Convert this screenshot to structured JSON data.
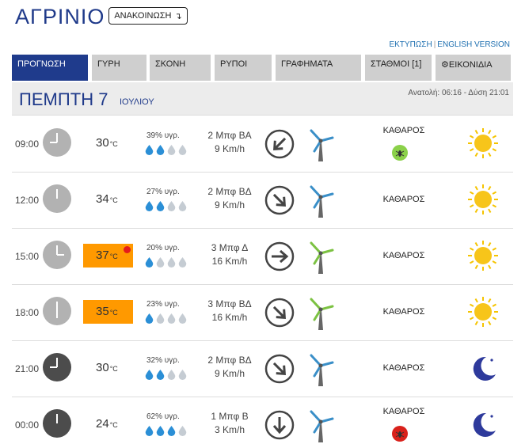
{
  "city": "ΑΓΡΙΝΙΟ",
  "announcement_button": "ΑΝΑΚΟΙΝΩΣΗ",
  "announcement_icon": "arrow-down-turn-icon",
  "links": {
    "print": "ΕΚΤΥΠΩΣΗ",
    "sep": "|",
    "english": "ENGLISH VERSION"
  },
  "tabs": [
    {
      "label": "ΠΡΟΓΝΩΣΗ",
      "active": true
    },
    {
      "label": "ΓΥΡΗ"
    },
    {
      "label": "ΣΚΟΝΗ"
    },
    {
      "label": "ΡΥΠΟΙ"
    },
    {
      "label": "ΓΡΑΦΗΜΑΤΑ"
    },
    {
      "label": "ΣΤΑΘΜΟΙ [1]"
    },
    {
      "label": "ΕΙΚΟΝΙΔΙΑ",
      "icon": "gear-icon"
    }
  ],
  "day": {
    "name": "ΠΕΜΠΤΗ 7",
    "month": "ΙΟΥΛΙΟΥ",
    "sun_times": "Ανατολή: 06:16 - Δύση 21:01"
  },
  "temp_unit": "°C",
  "colors": {
    "accent": "#1f3b8c",
    "hot": "#ff9900",
    "drop_filled": "#2b8fd6",
    "drop_empty": "#c5ccd3"
  },
  "rows": [
    {
      "time": "09:00",
      "clock": "day",
      "hour": 9,
      "temp": "30",
      "hot": false,
      "alert": false,
      "humidity": "39% υγρ.",
      "drops": 2,
      "wind_force": "2 Μπφ ΒΑ",
      "wind_speed": "9 Km/h",
      "arrow_deg": 225,
      "turbine": "blue",
      "condition": "ΚΑΘΑΡΟΣ",
      "badge": "green",
      "weather_icon": "sun-icon"
    },
    {
      "time": "12:00",
      "clock": "day",
      "hour": 12,
      "temp": "34",
      "hot": false,
      "alert": false,
      "humidity": "27% υγρ.",
      "drops": 2,
      "wind_force": "2 Μπφ ΒΔ",
      "wind_speed": "9 Km/h",
      "arrow_deg": 135,
      "turbine": "blue",
      "condition": "ΚΑΘΑΡΟΣ",
      "badge": null,
      "weather_icon": "sun-icon"
    },
    {
      "time": "15:00",
      "clock": "day",
      "hour": 3,
      "temp": "37",
      "hot": true,
      "alert": true,
      "humidity": "20% υγρ.",
      "drops": 1,
      "wind_force": "3 Μπφ Δ",
      "wind_speed": "16 Km/h",
      "arrow_deg": 90,
      "turbine": "green",
      "condition": "ΚΑΘΑΡΟΣ",
      "badge": null,
      "weather_icon": "sun-icon"
    },
    {
      "time": "18:00",
      "clock": "day",
      "hour": 6,
      "temp": "35",
      "hot": true,
      "alert": false,
      "humidity": "23% υγρ.",
      "drops": 1,
      "wind_force": "3 Μπφ ΒΔ",
      "wind_speed": "16 Km/h",
      "arrow_deg": 135,
      "turbine": "green",
      "condition": "ΚΑΘΑΡΟΣ",
      "badge": null,
      "weather_icon": "sun-icon"
    },
    {
      "time": "21:00",
      "clock": "night",
      "hour": 9,
      "temp": "30",
      "hot": false,
      "alert": false,
      "humidity": "32% υγρ.",
      "drops": 2,
      "wind_force": "2 Μπφ ΒΔ",
      "wind_speed": "9 Km/h",
      "arrow_deg": 135,
      "turbine": "blue",
      "condition": "ΚΑΘΑΡΟΣ",
      "badge": null,
      "weather_icon": "moon-icon"
    },
    {
      "time": "00:00",
      "clock": "night",
      "hour": 12,
      "temp": "24",
      "hot": false,
      "alert": false,
      "humidity": "62% υγρ.",
      "drops": 3,
      "wind_force": "1 Μπφ Β",
      "wind_speed": "3 Km/h",
      "arrow_deg": 180,
      "turbine": "blue",
      "condition": "ΚΑΘΑΡΟΣ",
      "badge": "red",
      "weather_icon": "moon-icon"
    }
  ]
}
